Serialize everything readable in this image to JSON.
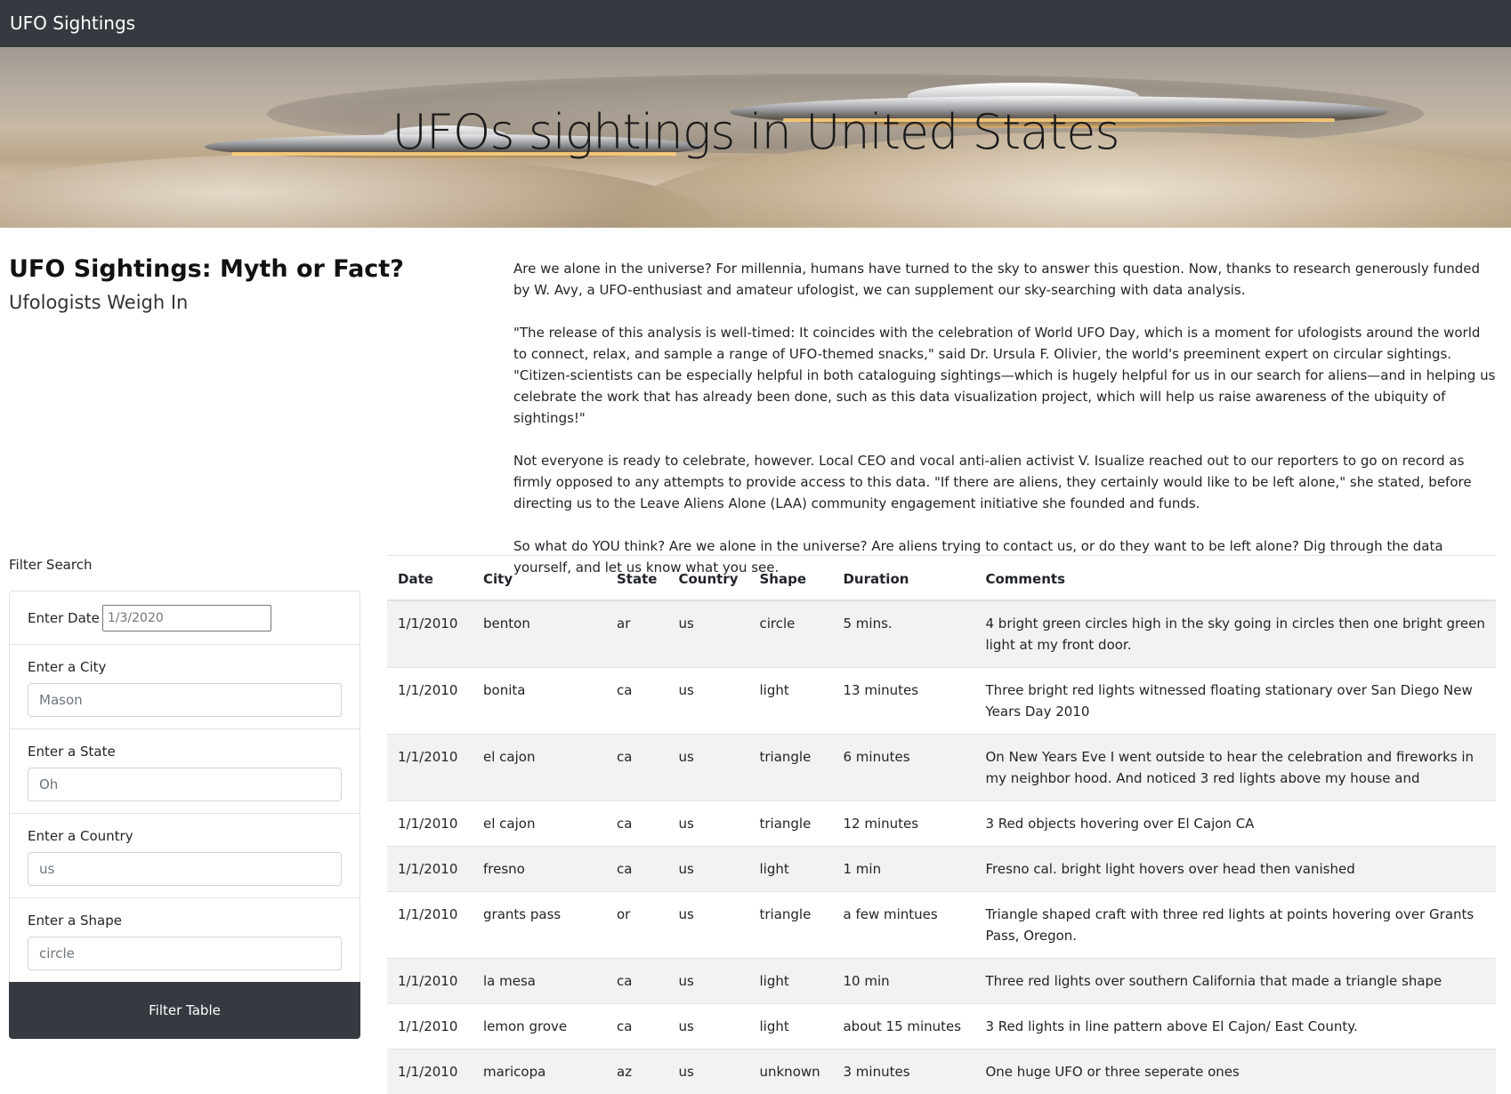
{
  "navbar": {
    "brand": "UFO Sightings"
  },
  "hero": {
    "title": "UFOs sightings in United States"
  },
  "heading": {
    "main": "UFO Sightings: Myth or Fact?",
    "sub": "Ufologists Weigh In"
  },
  "article": {
    "paragraphs": [
      "Are we alone in the universe? For millennia, humans have turned to the sky to answer this question. Now, thanks to research generously funded by W. Avy, a UFO-enthusiast and amateur ufologist, we can supplement our sky-searching with data analysis.",
      "\"The release of this analysis is well-timed: It coincides with the celebration of World UFO Day, which is a moment for ufologists around the world to connect, relax, and sample a range of UFO-themed snacks,\" said Dr. Ursula F. Olivier, the world's preeminent expert on circular sightings. \"Citizen-scientists can be especially helpful in both cataloguing sightings—which is hugely helpful for us in our search for aliens—and in helping us celebrate the work that has already been done, such as this data visualization project, which will help us raise awareness of the ubiquity of sightings!\"",
      "Not everyone is ready to celebrate, however. Local CEO and vocal anti-alien activist V. Isualize reached out to our reporters to go on record as firmly opposed to any attempts to provide access to this data. \"If there are aliens, they certainly would like to be left alone,\" she stated, before directing us to the Leave Aliens Alone (LAA) community engagement initiative she founded and funds.",
      "So what do YOU think? Are we alone in the universe? Are aliens trying to contact us, or do they want to be left alone? Dig through the data yourself, and let us know what you see."
    ]
  },
  "filter": {
    "title": "Filter Search",
    "date": {
      "label": "Enter Date",
      "placeholder": "1/3/2020"
    },
    "city": {
      "label": "Enter a City",
      "placeholder": "Mason"
    },
    "state": {
      "label": "Enter a State",
      "placeholder": "Oh"
    },
    "country": {
      "label": "Enter a Country",
      "placeholder": "us"
    },
    "shape": {
      "label": "Enter a Shape",
      "placeholder": "circle"
    },
    "button": "Filter Table"
  },
  "table": {
    "headers": [
      "Date",
      "City",
      "State",
      "Country",
      "Shape",
      "Duration",
      "Comments"
    ],
    "rows": [
      [
        "1/1/2010",
        "benton",
        "ar",
        "us",
        "circle",
        "5 mins.",
        "4 bright green circles high in the sky going in circles then one bright green light at my front door."
      ],
      [
        "1/1/2010",
        "bonita",
        "ca",
        "us",
        "light",
        "13 minutes",
        "Three bright red lights witnessed floating stationary over San Diego New Years Day 2010"
      ],
      [
        "1/1/2010",
        "el cajon",
        "ca",
        "us",
        "triangle",
        "6 minutes",
        "On New Years Eve I went outside to hear the celebration and fireworks in my neighbor hood. And noticed 3 red lights above my house and"
      ],
      [
        "1/1/2010",
        "el cajon",
        "ca",
        "us",
        "triangle",
        "12 minutes",
        "3 Red objects hovering over El Cajon CA"
      ],
      [
        "1/1/2010",
        "fresno",
        "ca",
        "us",
        "light",
        "1 min",
        "Fresno cal. bright light hovers over head then vanished"
      ],
      [
        "1/1/2010",
        "grants pass",
        "or",
        "us",
        "triangle",
        "a few mintues",
        "Triangle shaped craft with three red lights at points hovering over Grants Pass, Oregon."
      ],
      [
        "1/1/2010",
        "la mesa",
        "ca",
        "us",
        "light",
        "10 min",
        "Three red lights over southern California that made a triangle shape"
      ],
      [
        "1/1/2010",
        "lemon grove",
        "ca",
        "us",
        "light",
        "about 15 minutes",
        "3 Red lights in line pattern above El Cajon/ East County."
      ],
      [
        "1/1/2010",
        "maricopa",
        "az",
        "us",
        "unknown",
        "3 minutes",
        "One huge UFO or three seperate ones"
      ]
    ]
  }
}
